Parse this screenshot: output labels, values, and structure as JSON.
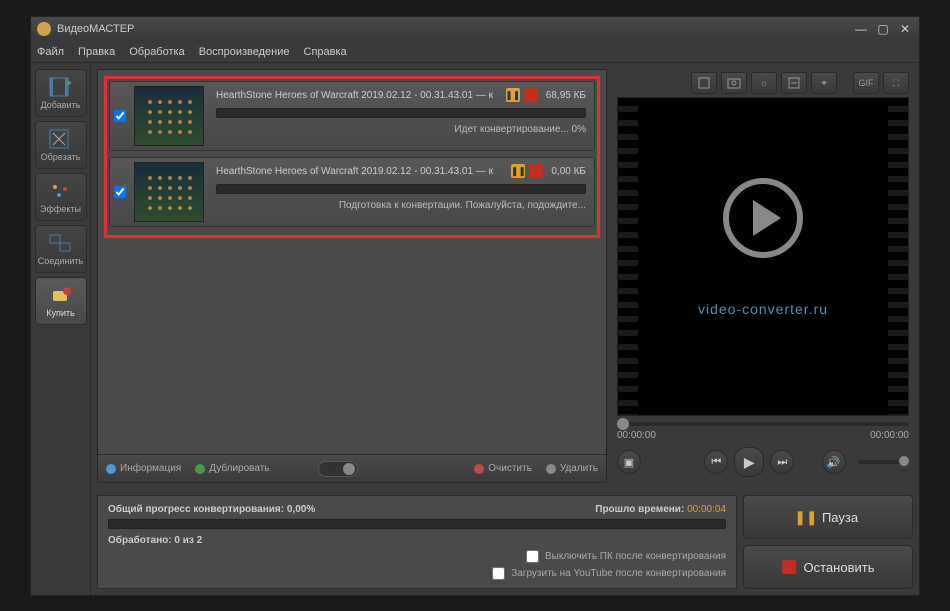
{
  "window": {
    "title": "ВидеоМАСТЕР"
  },
  "menu": {
    "file": "Файл",
    "edit": "Правка",
    "process": "Обработка",
    "playback": "Воспроизведение",
    "help": "Справка"
  },
  "sidebar": {
    "add": "Добавить",
    "trim": "Обрезать",
    "effects": "Эффекты",
    "join": "Соединить",
    "buy": "Купить"
  },
  "list": {
    "items": [
      {
        "filename": "HearthStone Heroes of Warcraft 2019.02.12 - 00.31.43.01 — к",
        "size": "68,95 КБ",
        "status": "Идет конвертирование... 0%"
      },
      {
        "filename": "HearthStone Heroes of Warcraft 2019.02.12 - 00.31.43.01 — к",
        "size": "0,00 КБ",
        "status": "Подготовка к конвертации. Пожалуйста, подождите..."
      }
    ],
    "toolbar": {
      "info": "Информация",
      "duplicate": "Дублировать",
      "clear": "Очистить",
      "delete": "Удалить"
    }
  },
  "preview": {
    "brand": "video-converter.ru",
    "time_start": "00:00:00",
    "time_end": "00:00:00",
    "toolbar": {
      "gif": "GIF"
    }
  },
  "progress": {
    "overall_label": "Общий прогресс конвертирования: 0,00%",
    "elapsed_label": "Прошло времени:",
    "elapsed_value": "00:00:04",
    "processed": "Обработано: 0 из 2",
    "opt_shutdown": "Выключить ПК после конвертирования",
    "opt_youtube": "Загрузить на YouTube после конвертирования"
  },
  "actions": {
    "pause": "Пауза",
    "stop": "Остановить"
  }
}
